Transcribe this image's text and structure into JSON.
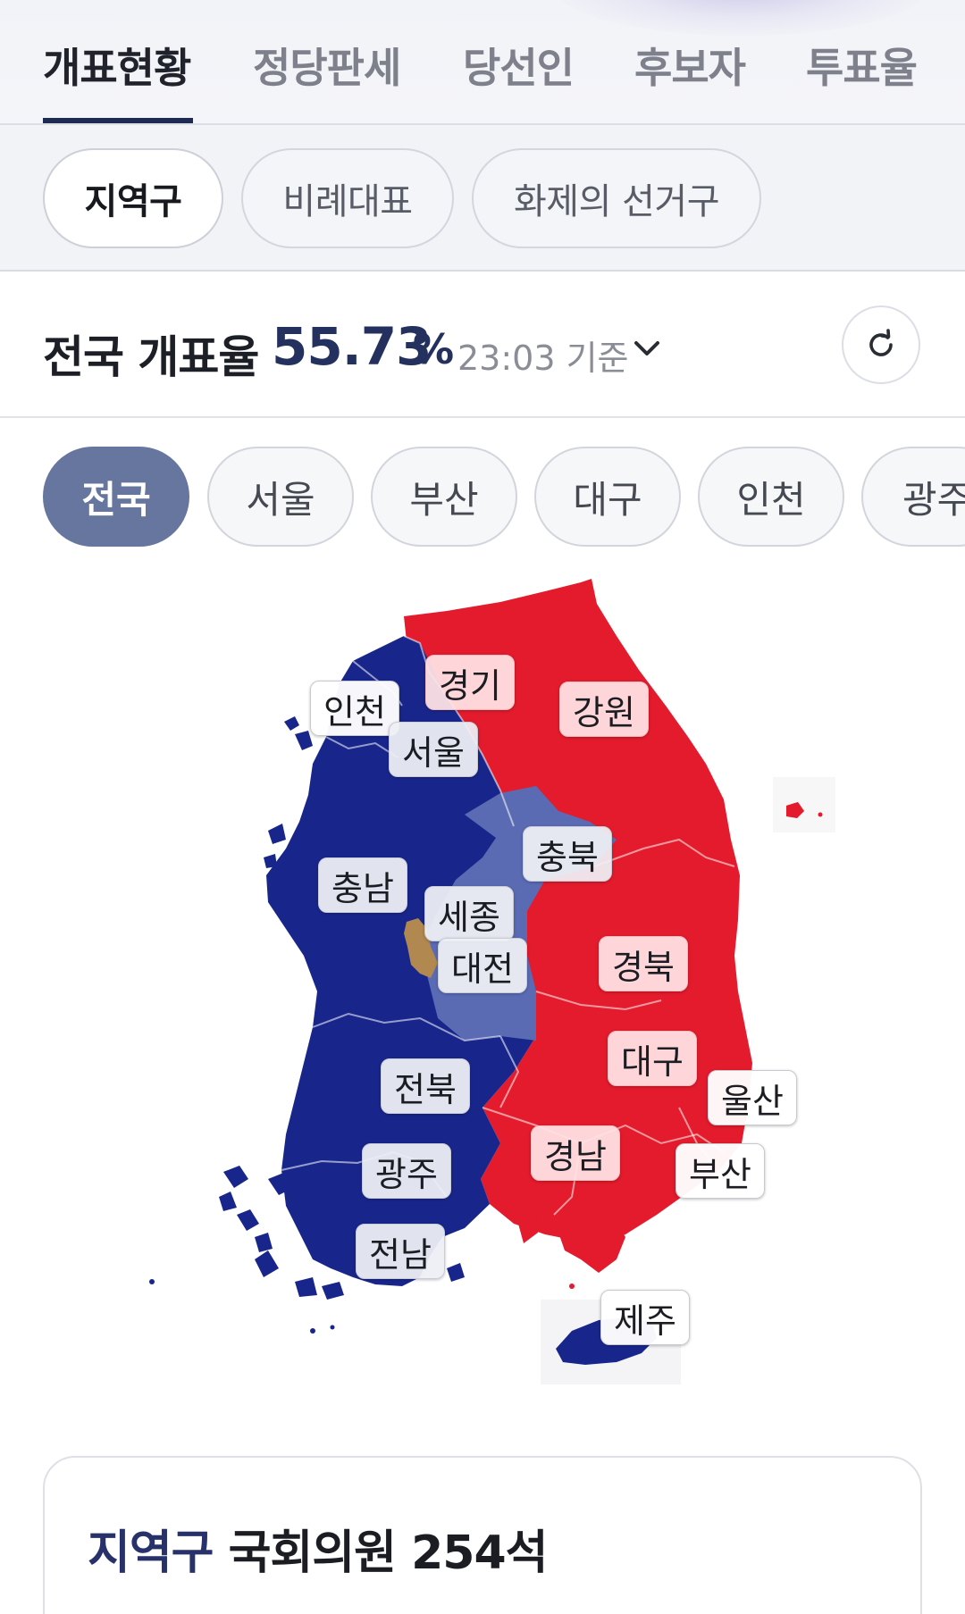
{
  "top_tabs": [
    {
      "label": "개표현황",
      "active": true
    },
    {
      "label": "정당판세",
      "active": false
    },
    {
      "label": "당선인",
      "active": false
    },
    {
      "label": "후보자",
      "active": false
    },
    {
      "label": "투표율",
      "active": false
    }
  ],
  "sub_tabs": [
    {
      "label": "지역구",
      "active": true
    },
    {
      "label": "비례대표",
      "active": false
    },
    {
      "label": "화제의 선거구",
      "active": false
    }
  ],
  "counting": {
    "label": "전국 개표율",
    "value": "55.73",
    "unit": "%",
    "time": "23:03 기준"
  },
  "region_chips": [
    {
      "label": "전국",
      "active": true
    },
    {
      "label": "서울",
      "active": false
    },
    {
      "label": "부산",
      "active": false
    },
    {
      "label": "대구",
      "active": false
    },
    {
      "label": "인천",
      "active": false
    },
    {
      "label": "광주",
      "active": false
    }
  ],
  "map": {
    "colors": {
      "red_party": "#e31b2c",
      "blue_party": "#18268c",
      "swing_light_blue": "#5a6bb4",
      "sejong_gold": "#b08850"
    },
    "regions": [
      {
        "label": "경기",
        "winner": "red_party"
      },
      {
        "label": "강원",
        "winner": "red_party"
      },
      {
        "label": "인천",
        "winner": "blue_party"
      },
      {
        "label": "서울",
        "winner": "blue_party"
      },
      {
        "label": "충북",
        "winner": "swing_light_blue"
      },
      {
        "label": "충남",
        "winner": "blue_party"
      },
      {
        "label": "세종",
        "winner": "swing_light_blue"
      },
      {
        "label": "대전",
        "winner": "swing_light_blue"
      },
      {
        "label": "경북",
        "winner": "red_party"
      },
      {
        "label": "대구",
        "winner": "red_party"
      },
      {
        "label": "울산",
        "winner": "red_party"
      },
      {
        "label": "전북",
        "winner": "blue_party"
      },
      {
        "label": "경남",
        "winner": "red_party"
      },
      {
        "label": "부산",
        "winner": "red_party"
      },
      {
        "label": "광주",
        "winner": "blue_party"
      },
      {
        "label": "전남",
        "winner": "blue_party"
      },
      {
        "label": "제주",
        "winner": "blue_party"
      }
    ]
  },
  "seats_card": {
    "title_accent": "지역구",
    "title_rest": "국회의원 254석"
  }
}
